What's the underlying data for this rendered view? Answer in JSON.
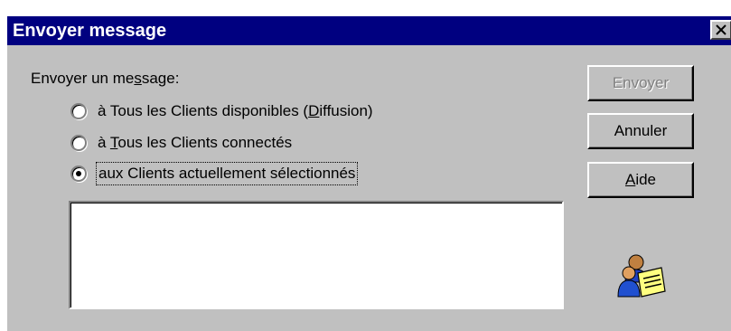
{
  "window": {
    "title": "Envoyer message"
  },
  "group": {
    "label_pre": "Envoyer un me",
    "label_underline": "s",
    "label_post": "sage:"
  },
  "options": [
    {
      "pre": "à Tous les Clients disponibles (",
      "underline": "D",
      "post": "iffusion)",
      "checked": false
    },
    {
      "pre": "à ",
      "underline": "T",
      "post": "ous les Clients connectés",
      "checked": false
    },
    {
      "pre": "aux Clients actuellement sélectionnés",
      "underline": "",
      "post": "",
      "checked": true
    }
  ],
  "message": {
    "value": ""
  },
  "buttons": {
    "send": "Envoyer",
    "cancel": "Annuler",
    "help_underline": "A",
    "help_rest": "ide"
  },
  "icons": {
    "close": "close-icon",
    "dialog": "users-message-icon"
  }
}
